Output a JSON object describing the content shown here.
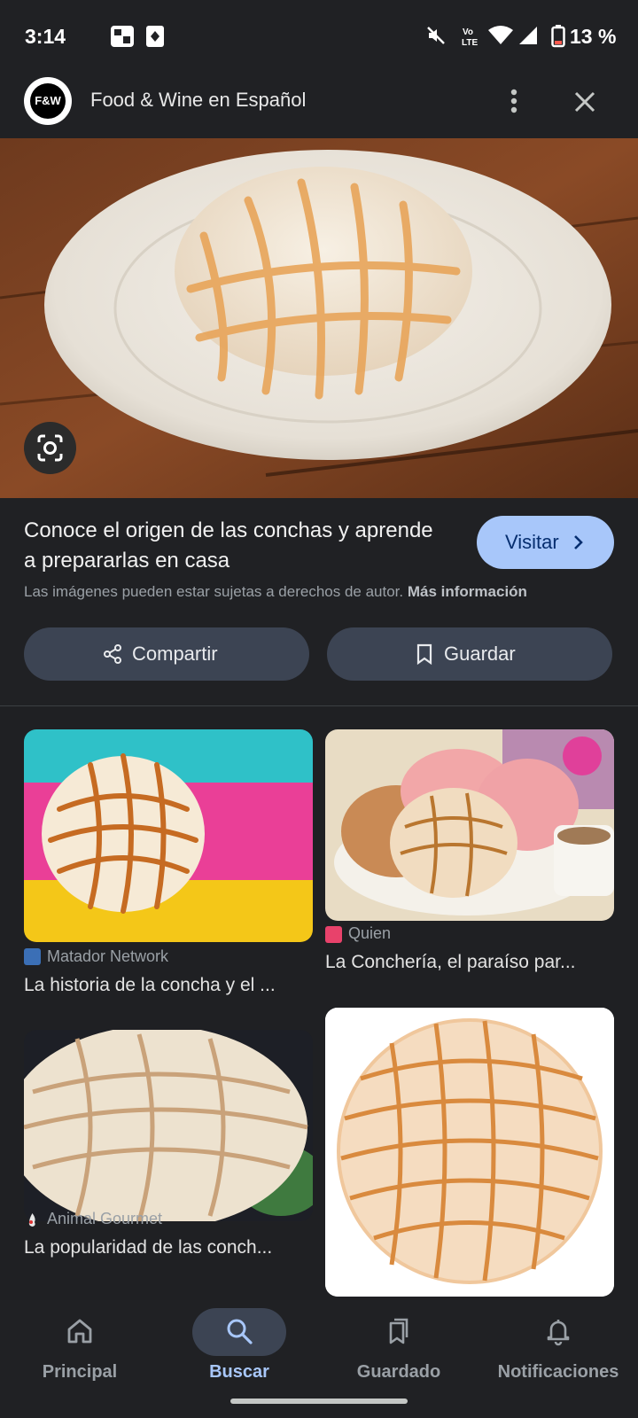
{
  "status_bar": {
    "time": "3:14",
    "battery": "13 %",
    "icons": [
      "moon-icon",
      "game-icon",
      "cards-icon",
      "mute-icon",
      "volte-icon",
      "wifi-icon",
      "signal-icon",
      "battery-icon"
    ]
  },
  "header": {
    "logo_text": "F&W",
    "title": "Food & Wine en Español",
    "more_icon": "more-vert-icon",
    "close_icon": "close-icon"
  },
  "hero": {
    "lens_icon": "google-lens-icon"
  },
  "info": {
    "headline": "Conoce el origen de las conchas y aprende a prepararlas en casa",
    "visit_label": "Visitar",
    "copyright_text": "Las imágenes pueden estar sujetas a derechos de autor.",
    "more_info": "Más información",
    "share_label": "Compartir",
    "save_label": "Guardar"
  },
  "results": [
    {
      "source": "Matador Network",
      "title": "La historia de la concha y el ...",
      "source_color": "#3b6fb6"
    },
    {
      "source": "Quien",
      "title": "La Conchería, el paraíso par...",
      "source_color": "#e8426b"
    },
    {
      "source": "Animal Gourmet",
      "title": "La popularidad de las conch...",
      "source_color": "#e7e7e7"
    },
    {
      "source": "",
      "title": ""
    }
  ],
  "bottom_nav": {
    "items": [
      {
        "label": "Principal",
        "icon": "home-icon"
      },
      {
        "label": "Buscar",
        "icon": "search-icon",
        "active": true
      },
      {
        "label": "Guardado",
        "icon": "bookmarks-icon"
      },
      {
        "label": "Notificaciones",
        "icon": "bell-icon"
      }
    ]
  },
  "colors": {
    "background": "#1f2023",
    "accent": "#a8c7fa",
    "button": "#3c4453"
  }
}
